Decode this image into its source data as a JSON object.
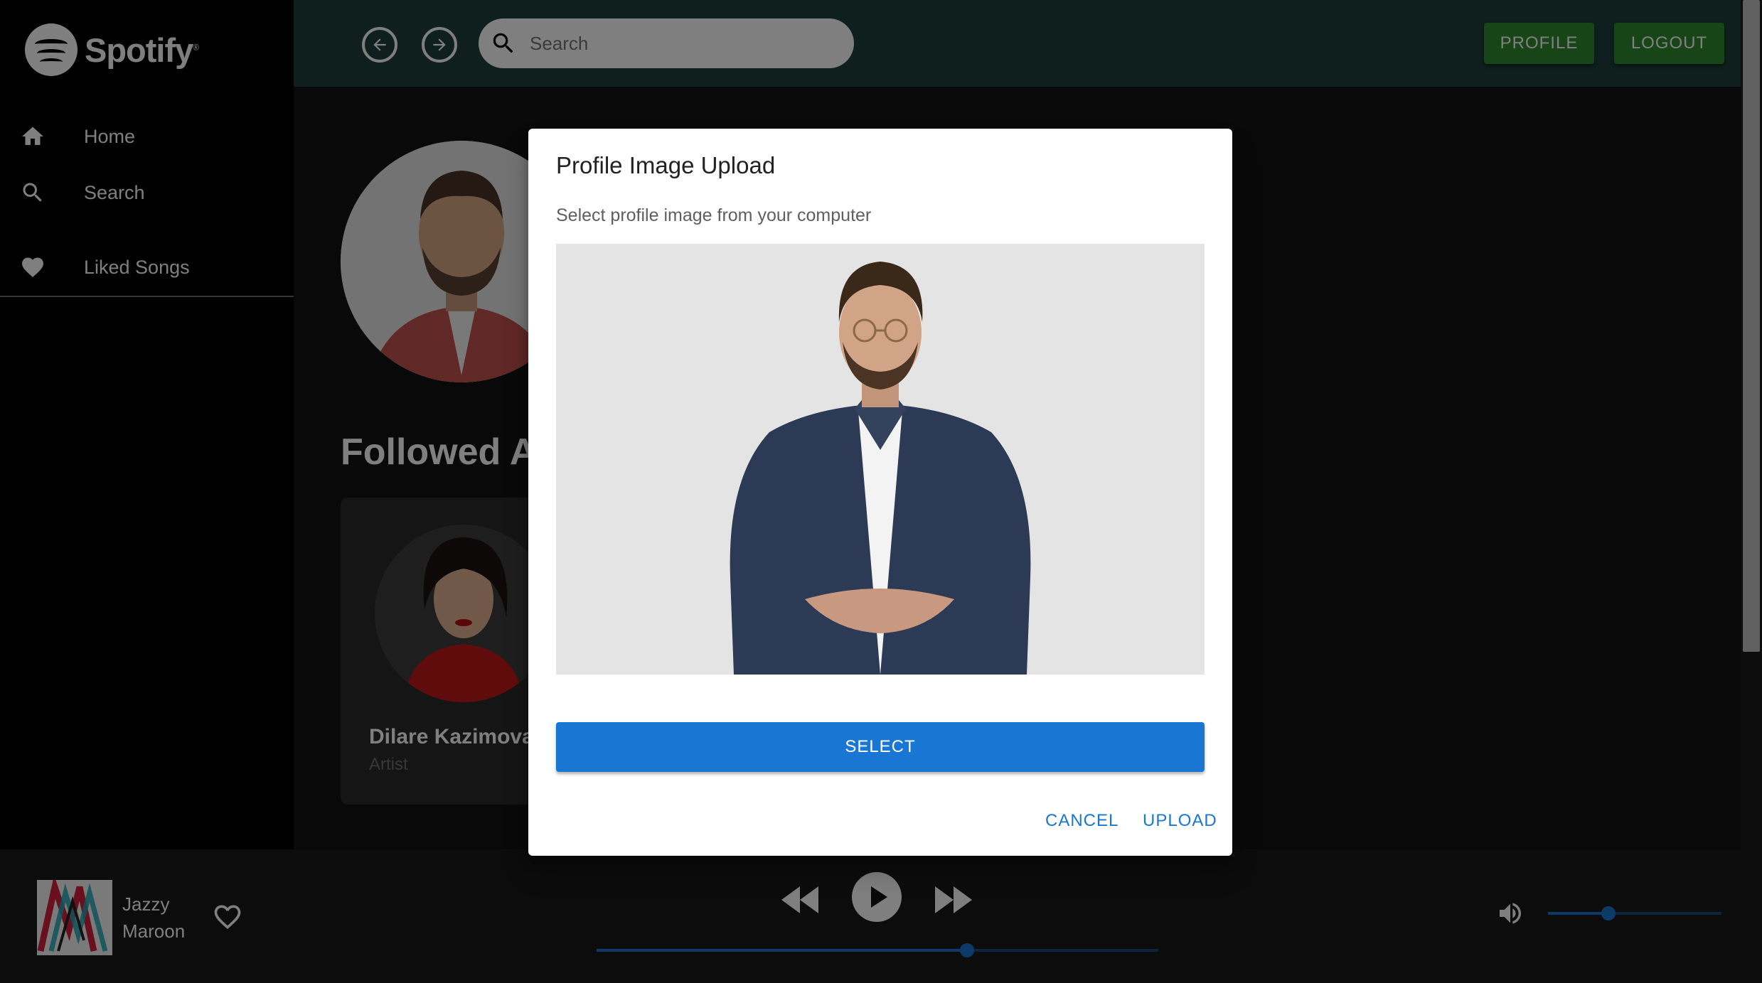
{
  "app": {
    "brand": "Spotify"
  },
  "sidebar": {
    "items": [
      {
        "label": "Home",
        "icon": "home-icon"
      },
      {
        "label": "Search",
        "icon": "search-icon"
      },
      {
        "label": "Liked Songs",
        "icon": "heart-icon"
      }
    ]
  },
  "header": {
    "search_placeholder": "Search",
    "profile_label": "PROFILE",
    "logout_label": "LOGOUT",
    "accent_color": "#2e8b2e"
  },
  "main": {
    "section_title": "Followed Artists",
    "artist": {
      "name": "Dilare Kazimova",
      "type": "Artist"
    }
  },
  "player": {
    "track_title": "Jazzy",
    "track_artist": "Maroon",
    "progress": 0.66,
    "volume": 0.35,
    "controls": [
      "skip-previous-icon",
      "play-icon",
      "skip-next-icon"
    ]
  },
  "dialog": {
    "title": "Profile Image Upload",
    "description": "Select profile image from your computer",
    "select_label": "SELECT",
    "cancel_label": "CANCEL",
    "upload_label": "UPLOAD",
    "primary_color": "#1976d2"
  }
}
